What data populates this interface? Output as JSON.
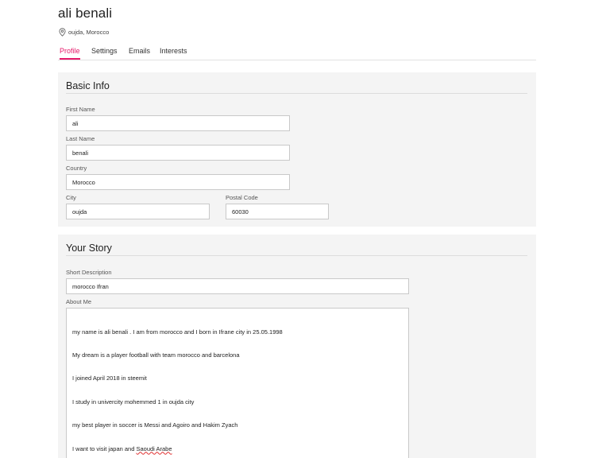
{
  "profile": {
    "name": "ali benali",
    "location": "oujda, Morocco"
  },
  "tabs": [
    {
      "label": "Profile",
      "active": true
    },
    {
      "label": "Settings",
      "active": false
    },
    {
      "label": "Emails",
      "active": false
    },
    {
      "label": "Interests",
      "active": false
    }
  ],
  "basic_info": {
    "title": "Basic Info",
    "first_name": {
      "label": "First Name",
      "value": "ali"
    },
    "last_name": {
      "label": "Last Name",
      "value": "benali"
    },
    "country": {
      "label": "Country",
      "value": "Morocco"
    },
    "city": {
      "label": "City",
      "value": "oujda"
    },
    "postal_code": {
      "label": "Postal Code",
      "value": "60030"
    }
  },
  "your_story": {
    "title": "Your Story",
    "short_description": {
      "label": "Short Description",
      "value": "morocco Ifran"
    },
    "about_me": {
      "label": "About Me",
      "lines": [
        "my name is ali benali . I am from morocco and I born in Ifrane city in 25.05.1998",
        "My dream is a player football with team morocco and barcelona",
        "I joined April 2018 in steemit",
        "I study in univercity mohemmed 1 in oujda city",
        "my best player in soccer is Messi and Agoiro and Hakim Zyach",
        "I want to visit japan and ",
        "Saoudi Arabe"
      ]
    }
  },
  "colors": {
    "accent": "#e5196a",
    "section_bg": "#f4f4f4",
    "input_border": "#c9c9c9"
  },
  "icons": {
    "location": "map-pin-icon"
  }
}
